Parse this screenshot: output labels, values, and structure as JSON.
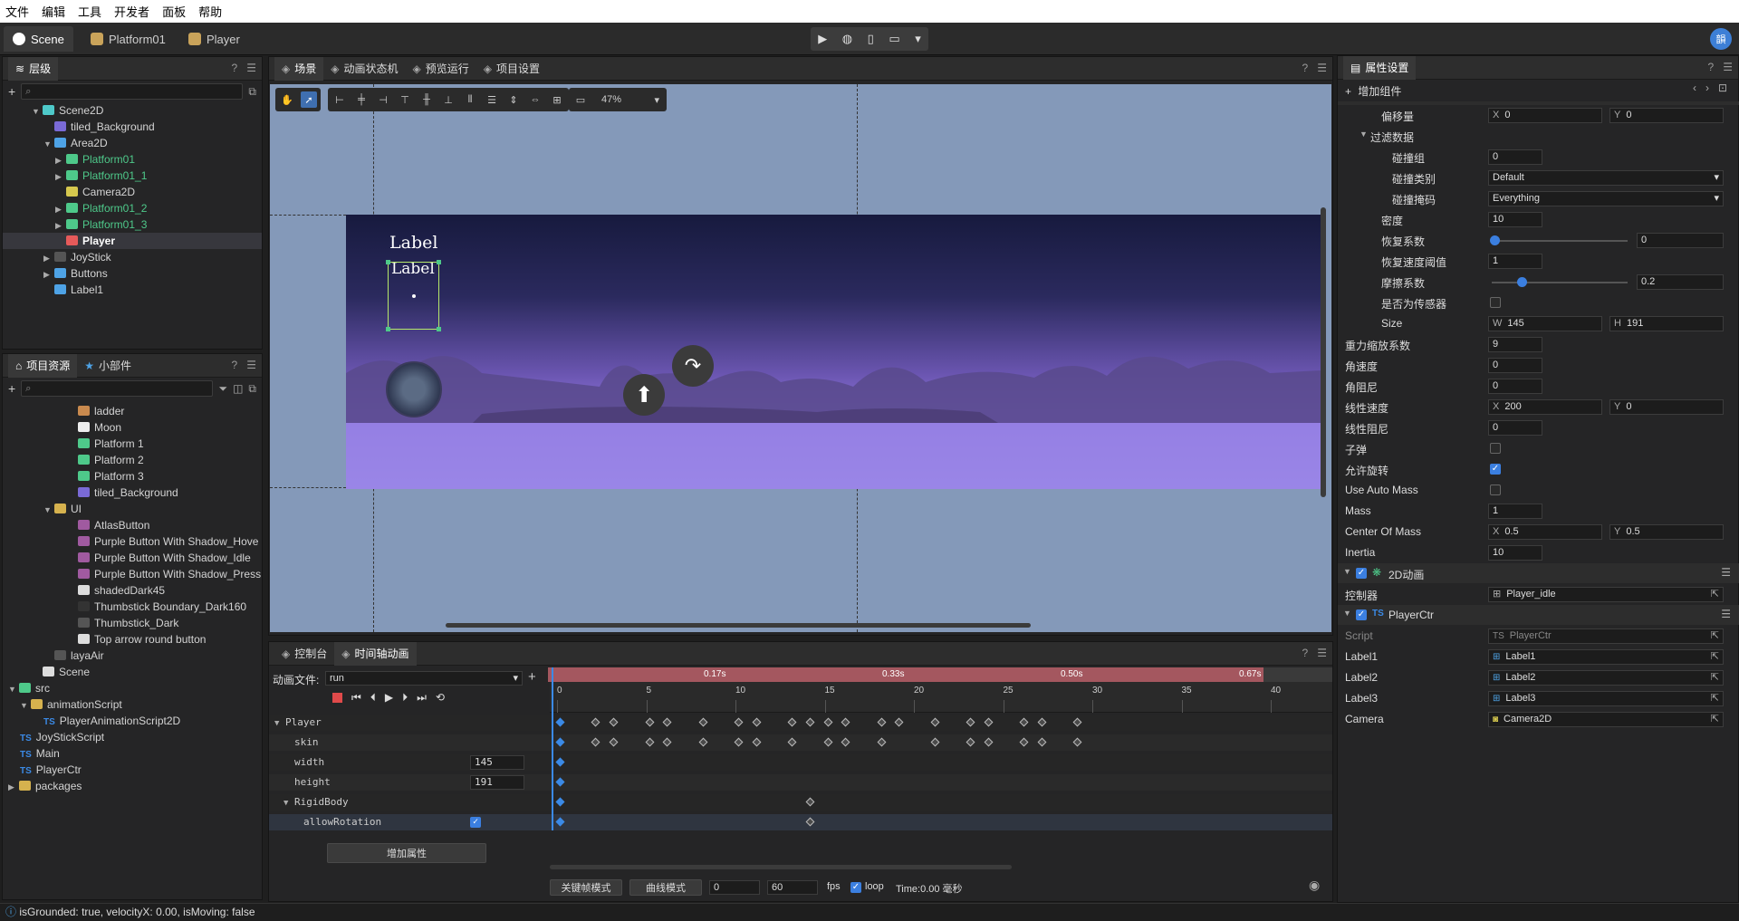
{
  "menu": [
    "文件",
    "编辑",
    "工具",
    "开发者",
    "面板",
    "帮助"
  ],
  "tabs": [
    {
      "label": "Scene",
      "active": true
    },
    {
      "label": "Platform01",
      "active": false
    },
    {
      "label": "Player",
      "active": false
    }
  ],
  "avatar": "韻",
  "hierarchy": {
    "title": "层级",
    "items": [
      {
        "label": "Scene2D",
        "indent": 2,
        "arrow": "▼",
        "color": "#4ec9c9",
        "green": false
      },
      {
        "label": "tiled_Background",
        "indent": 3,
        "arrow": "",
        "color": "#7a6ad6",
        "green": false
      },
      {
        "label": "Area2D",
        "indent": 3,
        "arrow": "▼",
        "color": "#4ea3e6",
        "green": false
      },
      {
        "label": "Platform01",
        "indent": 4,
        "arrow": "▶",
        "color": "#4ec98a",
        "green": true
      },
      {
        "label": "Platform01_1",
        "indent": 4,
        "arrow": "▶",
        "color": "#4ec98a",
        "green": true
      },
      {
        "label": "Camera2D",
        "indent": 4,
        "arrow": "",
        "color": "#d6c84e",
        "green": false
      },
      {
        "label": "Platform01_2",
        "indent": 4,
        "arrow": "▶",
        "color": "#4ec98a",
        "green": true
      },
      {
        "label": "Platform01_3",
        "indent": 4,
        "arrow": "▶",
        "color": "#4ec98a",
        "green": true
      },
      {
        "label": "Player",
        "indent": 4,
        "arrow": "",
        "color": "#e65a5a",
        "green": false,
        "selected": true
      },
      {
        "label": "JoyStick",
        "indent": 3,
        "arrow": "▶",
        "color": "#555555",
        "green": false
      },
      {
        "label": "Buttons",
        "indent": 3,
        "arrow": "▶",
        "color": "#4ea3e6",
        "green": false
      },
      {
        "label": "Label1",
        "indent": 3,
        "arrow": "",
        "color": "#4ea3e6",
        "green": false
      }
    ]
  },
  "assets": {
    "tab1": "项目资源",
    "tab2": "小部件",
    "items": [
      {
        "label": "ladder",
        "indent": 5,
        "arrow": "",
        "color": "#c98a4e"
      },
      {
        "label": "Moon",
        "indent": 5,
        "arrow": "",
        "color": "#eeeeee"
      },
      {
        "label": "Platform 1",
        "indent": 5,
        "arrow": "",
        "color": "#4ec98a"
      },
      {
        "label": "Platform 2",
        "indent": 5,
        "arrow": "",
        "color": "#4ec98a"
      },
      {
        "label": "Platform 3",
        "indent": 5,
        "arrow": "",
        "color": "#4ec98a"
      },
      {
        "label": "tiled_Background",
        "indent": 5,
        "arrow": "",
        "color": "#7a6ad6"
      },
      {
        "label": "UI",
        "indent": 3,
        "arrow": "▼",
        "color": "#d6b24e"
      },
      {
        "label": "AtlasButton",
        "indent": 5,
        "arrow": "",
        "color": "#a05aa0"
      },
      {
        "label": "Purple Button With Shadow_Hove",
        "indent": 5,
        "arrow": "",
        "color": "#a05aa0"
      },
      {
        "label": "Purple Button With Shadow_Idle",
        "indent": 5,
        "arrow": "",
        "color": "#a05aa0"
      },
      {
        "label": "Purple Button With Shadow_Press",
        "indent": 5,
        "arrow": "",
        "color": "#a05aa0"
      },
      {
        "label": "shadedDark45",
        "indent": 5,
        "arrow": "",
        "color": "#dddddd"
      },
      {
        "label": "Thumbstick Boundary_Dark160",
        "indent": 5,
        "arrow": "",
        "color": "#333333"
      },
      {
        "label": "Thumbstick_Dark",
        "indent": 5,
        "arrow": "",
        "color": "#555555"
      },
      {
        "label": "Top arrow round button",
        "indent": 5,
        "arrow": "",
        "color": "#dddddd"
      },
      {
        "label": "layaAir",
        "indent": 3,
        "arrow": "",
        "color": "#555555"
      },
      {
        "label": "Scene",
        "indent": 2,
        "arrow": "",
        "color": "#dddddd"
      },
      {
        "label": "src",
        "indent": 0,
        "arrow": "▼",
        "color": "#4ec98a"
      },
      {
        "label": "animationScript",
        "indent": 1,
        "arrow": "▼",
        "color": "#d6b24e"
      },
      {
        "label": "PlayerAnimationScript2D",
        "indent": 3,
        "arrow": "TS",
        "color": ""
      },
      {
        "label": "JoyStickScript",
        "indent": 1,
        "arrow": "TS",
        "color": ""
      },
      {
        "label": "Main",
        "indent": 1,
        "arrow": "TS",
        "color": ""
      },
      {
        "label": "PlayerCtr",
        "indent": 1,
        "arrow": "TS",
        "color": ""
      },
      {
        "label": "packages",
        "indent": 0,
        "arrow": "▶",
        "color": "#d6b24e"
      }
    ]
  },
  "center_tabs": [
    {
      "label": "场景",
      "active": true
    },
    {
      "label": "动画状态机",
      "active": false
    },
    {
      "label": "预览运行",
      "active": false
    },
    {
      "label": "项目设置",
      "active": false
    }
  ],
  "zoom": "47%",
  "scene_labels": [
    "Label",
    "Label"
  ],
  "bottom_tabs": [
    {
      "label": "控制台",
      "active": false
    },
    {
      "label": "时间轴动画",
      "active": true
    }
  ],
  "timeline": {
    "anim_file_label": "动画文件:",
    "anim_file": "run",
    "ruler_times": [
      "0.17s",
      "0.33s",
      "0.50s",
      "0.67s"
    ],
    "ruler_frames": [
      "0",
      "5",
      "10",
      "15",
      "20",
      "25",
      "30",
      "35",
      "40"
    ],
    "tracks": [
      {
        "label": "Player",
        "indent": 0,
        "arrow": "▼"
      },
      {
        "label": "skin",
        "indent": 1,
        "arrow": ""
      },
      {
        "label": "width",
        "indent": 1,
        "arrow": "",
        "value": "145"
      },
      {
        "label": "height",
        "indent": 1,
        "arrow": "",
        "value": "191"
      },
      {
        "label": "RigidBody",
        "indent": 1,
        "arrow": "▼"
      },
      {
        "label": "allowRotation",
        "indent": 2,
        "arrow": "",
        "checkbox": true
      }
    ],
    "add_property": "增加属性",
    "keyframe_mode": "关键帧模式",
    "curve_mode": "曲线模式",
    "frame": "0",
    "fps_value": "60",
    "fps": "fps",
    "loop": "loop",
    "time": "Time:0.00 毫秒"
  },
  "inspector": {
    "title": "属性设置",
    "add_component": "增加组件",
    "rows": [
      {
        "label": "偏移量",
        "indent": 2,
        "type": "xy",
        "x": "0",
        "y": "0"
      },
      {
        "label": "过滤数据",
        "indent": 1,
        "type": "group"
      },
      {
        "label": "碰撞组",
        "indent": 3,
        "type": "num",
        "value": "0"
      },
      {
        "label": "碰撞类别",
        "indent": 3,
        "type": "select",
        "value": "Default"
      },
      {
        "label": "碰撞掩码",
        "indent": 3,
        "type": "select",
        "value": "Everything"
      },
      {
        "label": "密度",
        "indent": 2,
        "type": "num",
        "value": "10"
      },
      {
        "label": "恢复系数",
        "indent": 2,
        "type": "slider",
        "value": "0",
        "frac": 0
      },
      {
        "label": "恢复速度阈值",
        "indent": 2,
        "type": "num",
        "value": "1"
      },
      {
        "label": "摩擦系数",
        "indent": 2,
        "type": "slider",
        "value": "0.2",
        "frac": 0.2
      },
      {
        "label": "是否为传感器",
        "indent": 2,
        "type": "check",
        "checked": false
      },
      {
        "label": "Size",
        "indent": 2,
        "type": "wh",
        "x": "145",
        "y": "191"
      },
      {
        "label": "重力缩放系数",
        "indent": 0,
        "type": "num",
        "value": "9"
      },
      {
        "label": "角速度",
        "indent": 0,
        "type": "num",
        "value": "0"
      },
      {
        "label": "角阻尼",
        "indent": 0,
        "type": "num",
        "value": "0"
      },
      {
        "label": "线性速度",
        "indent": 0,
        "type": "xy",
        "x": "200",
        "y": "0"
      },
      {
        "label": "线性阻尼",
        "indent": 0,
        "type": "num",
        "value": "0"
      },
      {
        "label": "子弹",
        "indent": 0,
        "type": "check",
        "checked": false
      },
      {
        "label": "允许旋转",
        "indent": 0,
        "type": "check",
        "checked": true
      },
      {
        "label": "Use Auto Mass",
        "indent": 0,
        "type": "check",
        "checked": false
      },
      {
        "label": "Mass",
        "indent": 0,
        "type": "num",
        "value": "1"
      },
      {
        "label": "Center Of Mass",
        "indent": 0,
        "type": "xy",
        "x": "0.5",
        "y": "0.5"
      },
      {
        "label": "Inertia",
        "indent": 0,
        "type": "num",
        "value": "10"
      }
    ],
    "comp_anim": {
      "title": "2D动画",
      "label": "控制器",
      "value": "Player_idle"
    },
    "comp_script": {
      "title": "PlayerCtr",
      "rows": [
        {
          "label": "Script",
          "value": "PlayerCtr",
          "dim": true,
          "icon": "TS"
        },
        {
          "label": "Label1",
          "value": "Label1",
          "icon": "box"
        },
        {
          "label": "Label2",
          "value": "Label2",
          "icon": "box"
        },
        {
          "label": "Label3",
          "value": "Label3",
          "icon": "box"
        },
        {
          "label": "Camera",
          "value": "Camera2D",
          "icon": "cam"
        }
      ]
    }
  },
  "status": "isGrounded: true, velocityX: 0.00, isMoving: false",
  "colors": {
    "accent": "#3b7fe0",
    "scene_bg": "#8499b9",
    "ruler": "#a4575f"
  }
}
